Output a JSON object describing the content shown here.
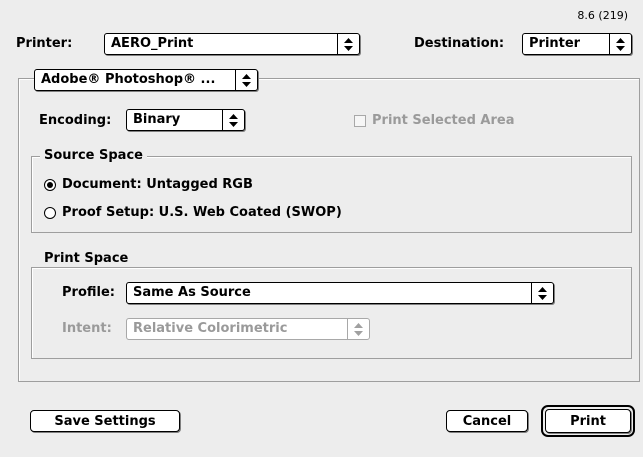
{
  "version": "8.6 (219)",
  "printer": {
    "label": "Printer:",
    "value": "AERO_Print"
  },
  "destination": {
    "label": "Destination:",
    "value": "Printer"
  },
  "panel_popup": {
    "value": "Adobe® Photoshop® ..."
  },
  "encoding": {
    "label": "Encoding:",
    "value": "Binary"
  },
  "print_selected_area": {
    "label": "Print Selected Area",
    "checked": false,
    "enabled": false
  },
  "source_space": {
    "title": "Source Space",
    "options": [
      {
        "label": "Document: Untagged RGB",
        "selected": true
      },
      {
        "label": "Proof Setup: U.S. Web Coated (SWOP)",
        "selected": false
      }
    ]
  },
  "print_space": {
    "title": "Print Space",
    "profile": {
      "label": "Profile:",
      "value": "Same As Source"
    },
    "intent": {
      "label": "Intent:",
      "value": "Relative Colorimetric",
      "enabled": false
    }
  },
  "buttons": {
    "save_settings": "Save Settings",
    "cancel": "Cancel",
    "print": "Print"
  },
  "icons": {
    "popup_arrow": "up-down-arrows-icon"
  }
}
